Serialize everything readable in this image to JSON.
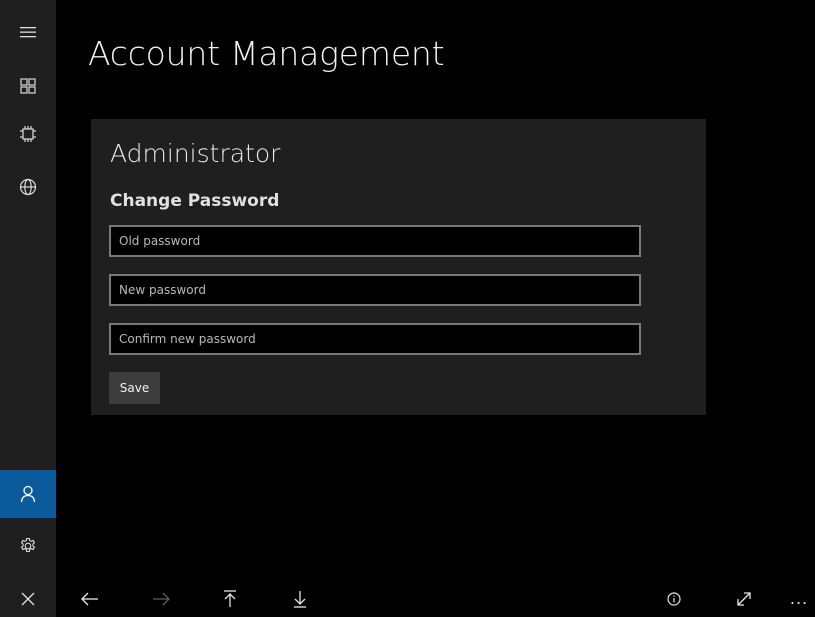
{
  "page": {
    "title": "Account Management"
  },
  "nav": {
    "items": [
      {
        "name": "menu",
        "icon": "hamburger-icon"
      },
      {
        "name": "apps",
        "icon": "apps-grid-icon"
      },
      {
        "name": "device",
        "icon": "chip-icon"
      },
      {
        "name": "network",
        "icon": "globe-icon"
      },
      {
        "name": "account",
        "icon": "person-icon",
        "active": true
      },
      {
        "name": "settings",
        "icon": "gear-icon"
      },
      {
        "name": "close",
        "icon": "close-icon"
      }
    ],
    "active_color": "#0b5a9b"
  },
  "account": {
    "heading": "Administrator",
    "section": "Change Password",
    "old_password_placeholder": "Old password",
    "new_password_placeholder": "New password",
    "confirm_password_placeholder": "Confirm new password",
    "save_label": "Save"
  },
  "appbar": {
    "buttons": [
      {
        "name": "back",
        "icon": "arrow-left-icon",
        "enabled": true
      },
      {
        "name": "forward",
        "icon": "arrow-right-icon",
        "enabled": false
      },
      {
        "name": "scroll-top",
        "icon": "arrow-up-to-top-icon",
        "enabled": true
      },
      {
        "name": "scroll-bottom",
        "icon": "arrow-down-to-bottom-icon",
        "enabled": true
      },
      {
        "name": "info",
        "icon": "info-icon",
        "enabled": true
      },
      {
        "name": "expand",
        "icon": "expand-icon",
        "enabled": true
      },
      {
        "name": "more",
        "icon": "more-icon",
        "glyph": "...",
        "enabled": true
      }
    ]
  }
}
